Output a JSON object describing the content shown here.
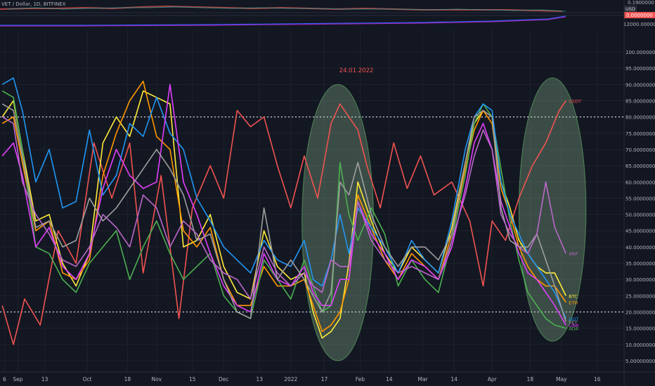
{
  "header": {
    "symbol_line": "VET / Dollar, 1D, BITFINEX"
  },
  "top_panel": {
    "price_axis": {
      "label_top": "0.1900000",
      "label_bottom": "0.0000000",
      "unit": "USD"
    },
    "indicator_axis": {
      "label_top": "12000.0000000"
    }
  },
  "annotation": {
    "date_label": "24.01.2022"
  },
  "colors": {
    "background": "#131722",
    "grid": "#1e222d",
    "axis_text": "#b2b5be",
    "USDT": "#f05350",
    "BTC": "#ffeb3b",
    "ETH": "#ff9800",
    "ADA": "#4caf50",
    "DOT": "#2196f3",
    "LINK": "#e040fb",
    "VET": "#9e9e9e",
    "XRP": "#ba68c8",
    "ellipse_fill": "#a5d6a7",
    "ellipse_stroke": "#66bb6a"
  },
  "chart_data": {
    "type": "line",
    "title": "",
    "xlabel": "",
    "ylabel": "",
    "ylim": [
      0,
      100
    ],
    "yticks": [
      "5.00000000",
      "10.00000000",
      "15.00000000",
      "20.00000000",
      "25.00000000",
      "30.00000000",
      "35.00000000",
      "40.00000000",
      "45.00000000",
      "50.00000000",
      "55.00000000",
      "60.00000000",
      "65.00000000",
      "70.00000000",
      "75.00000000",
      "80.00000000",
      "85.00000000",
      "90.00000000",
      "95.00000000",
      "100.00000000"
    ],
    "ytick_values": [
      5,
      10,
      15,
      20,
      25,
      30,
      35,
      40,
      45,
      50,
      55,
      60,
      65,
      70,
      75,
      80,
      85,
      90,
      95,
      100
    ],
    "xticks": [
      "6",
      "Sep",
      "13",
      "Oct",
      "18",
      "Nov",
      "15",
      "Dec",
      "13",
      "2022",
      "17",
      "Feb",
      "14",
      "Mar",
      "14",
      "Apr",
      "18",
      "May",
      "16"
    ],
    "xtick_days": [
      -4,
      2,
      14,
      33,
      51,
      64,
      80,
      94,
      110,
      124,
      139,
      155,
      168,
      183,
      197,
      214,
      231,
      245,
      261
    ],
    "x_axis_start": "2021-08-27",
    "x_range_days": [
      -6,
      273
    ],
    "reference_lines": [
      80,
      20
    ],
    "series": [
      {
        "name": "USDT",
        "color": "#f05350",
        "end_label": "USDT",
        "label_value": 85,
        "x": [
          -5,
          0,
          5,
          12,
          20,
          28,
          36,
          44,
          52,
          58,
          66,
          74,
          80,
          88,
          94,
          100,
          106,
          112,
          118,
          124,
          130,
          136,
          142,
          146,
          150,
          154,
          158,
          164,
          170,
          176,
          182,
          188,
          196,
          204,
          210,
          214,
          220,
          226,
          232,
          238,
          244,
          247
        ],
        "y": [
          22,
          10,
          24,
          16,
          45,
          35,
          72,
          55,
          72,
          32,
          62,
          18,
          52,
          65,
          55,
          82,
          77,
          80,
          65,
          52,
          68,
          55,
          78,
          84,
          80,
          76,
          65,
          52,
          72,
          58,
          68,
          56,
          60,
          48,
          28,
          48,
          42,
          55,
          65,
          72,
          82,
          85
        ]
      },
      {
        "name": "BTC",
        "color": "#ffeb3b",
        "end_label": "BTC",
        "label_value": 25,
        "x": [
          -5,
          0,
          4,
          10,
          16,
          22,
          28,
          34,
          40,
          46,
          52,
          58,
          64,
          70,
          76,
          82,
          88,
          94,
          100,
          106,
          112,
          118,
          124,
          130,
          134,
          138,
          142,
          146,
          150,
          154,
          160,
          166,
          172,
          178,
          184,
          190,
          196,
          202,
          206,
          210,
          214,
          218,
          222,
          226,
          230,
          234,
          238,
          242,
          247
        ],
        "y": [
          80,
          85,
          70,
          48,
          50,
          35,
          28,
          38,
          72,
          80,
          74,
          88,
          86,
          84,
          40,
          42,
          50,
          34,
          26,
          24,
          45,
          34,
          30,
          32,
          20,
          12,
          14,
          18,
          35,
          60,
          48,
          38,
          32,
          40,
          36,
          32,
          46,
          66,
          78,
          82,
          80,
          60,
          52,
          42,
          38,
          34,
          32,
          32,
          25
        ]
      },
      {
        "name": "ETH",
        "color": "#ff9800",
        "end_label": "ETH",
        "label_value": 23,
        "x": [
          -5,
          0,
          4,
          10,
          16,
          22,
          28,
          34,
          40,
          46,
          52,
          58,
          64,
          70,
          76,
          82,
          88,
          94,
          100,
          106,
          112,
          118,
          124,
          130,
          134,
          138,
          142,
          146,
          150,
          154,
          160,
          166,
          172,
          178,
          184,
          190,
          196,
          202,
          206,
          210,
          214,
          218,
          222,
          226,
          230,
          234,
          238,
          242,
          247
        ],
        "y": [
          78,
          80,
          66,
          45,
          48,
          32,
          30,
          36,
          62,
          75,
          85,
          91,
          74,
          70,
          45,
          40,
          46,
          30,
          22,
          22,
          34,
          28,
          28,
          30,
          22,
          14,
          16,
          20,
          30,
          56,
          46,
          36,
          30,
          38,
          34,
          30,
          44,
          64,
          76,
          82,
          78,
          58,
          50,
          40,
          34,
          30,
          28,
          28,
          23
        ]
      },
      {
        "name": "ADA",
        "color": "#4caf50",
        "end_label": "ADA",
        "label_value": 15,
        "x": [
          -5,
          0,
          4,
          10,
          16,
          22,
          28,
          34,
          40,
          46,
          52,
          58,
          64,
          70,
          76,
          82,
          88,
          94,
          100,
          106,
          112,
          118,
          124,
          130,
          134,
          138,
          142,
          146,
          150,
          154,
          160,
          166,
          172,
          178,
          184,
          190,
          196,
          202,
          206,
          210,
          214,
          218,
          222,
          226,
          230,
          234,
          238,
          242,
          247
        ],
        "y": [
          88,
          86,
          70,
          40,
          38,
          30,
          26,
          35,
          40,
          45,
          30,
          40,
          48,
          38,
          30,
          34,
          38,
          25,
          20,
          18,
          36,
          30,
          24,
          36,
          28,
          20,
          22,
          66,
          50,
          42,
          52,
          44,
          28,
          36,
          30,
          26,
          42,
          62,
          78,
          84,
          80,
          64,
          48,
          36,
          26,
          22,
          18,
          16,
          15
        ]
      },
      {
        "name": "DOT",
        "color": "#2196f3",
        "end_label": "DOT",
        "label_value": 18,
        "x": [
          -5,
          0,
          4,
          10,
          16,
          22,
          28,
          34,
          40,
          46,
          52,
          58,
          64,
          70,
          76,
          82,
          88,
          94,
          100,
          106,
          112,
          118,
          124,
          130,
          134,
          138,
          142,
          146,
          150,
          154,
          160,
          166,
          172,
          178,
          184,
          190,
          196,
          202,
          206,
          210,
          214,
          218,
          222,
          226,
          230,
          234,
          238,
          242,
          247
        ],
        "y": [
          90,
          92,
          82,
          60,
          70,
          52,
          54,
          76,
          56,
          62,
          78,
          74,
          86,
          75,
          70,
          55,
          48,
          40,
          36,
          32,
          42,
          36,
          34,
          42,
          30,
          28,
          36,
          50,
          38,
          52,
          46,
          40,
          32,
          42,
          36,
          32,
          48,
          70,
          80,
          84,
          82,
          60,
          50,
          44,
          38,
          34,
          30,
          26,
          18
        ]
      },
      {
        "name": "LINK",
        "color": "#e040fb",
        "end_label": "LINK",
        "label_value": 16,
        "x": [
          -5,
          0,
          4,
          10,
          16,
          22,
          28,
          34,
          40,
          46,
          52,
          58,
          64,
          70,
          76,
          82,
          88,
          94,
          100,
          106,
          112,
          118,
          124,
          130,
          134,
          138,
          142,
          146,
          150,
          154,
          160,
          166,
          172,
          178,
          184,
          190,
          196,
          202,
          206,
          210,
          214,
          218,
          222,
          226,
          230,
          234,
          238,
          242,
          247
        ],
        "y": [
          68,
          72,
          62,
          40,
          46,
          34,
          30,
          38,
          58,
          70,
          62,
          58,
          60,
          90,
          60,
          50,
          38,
          28,
          22,
          20,
          38,
          30,
          28,
          34,
          26,
          22,
          22,
          30,
          30,
          54,
          44,
          38,
          30,
          36,
          34,
          30,
          40,
          58,
          72,
          78,
          70,
          54,
          46,
          38,
          32,
          30,
          26,
          22,
          16
        ]
      },
      {
        "name": "VET",
        "color": "#9e9e9e",
        "end_label": "VET",
        "label_value": 17,
        "x": [
          -5,
          0,
          4,
          10,
          16,
          22,
          28,
          34,
          40,
          46,
          52,
          58,
          64,
          70,
          76,
          82,
          88,
          94,
          100,
          106,
          112,
          118,
          124,
          130,
          134,
          138,
          142,
          146,
          150,
          154,
          160,
          166,
          172,
          178,
          184,
          190,
          196,
          202,
          206,
          210,
          214,
          218,
          222,
          226,
          230,
          234,
          238,
          242,
          247
        ],
        "y": [
          84,
          82,
          68,
          46,
          48,
          40,
          42,
          55,
          48,
          52,
          58,
          64,
          70,
          64,
          56,
          42,
          44,
          30,
          20,
          18,
          52,
          30,
          36,
          30,
          25,
          20,
          26,
          60,
          56,
          66,
          50,
          40,
          34,
          40,
          40,
          36,
          44,
          66,
          80,
          82,
          80,
          52,
          42,
          40,
          40,
          44,
          36,
          28,
          17
        ]
      },
      {
        "name": "XRP",
        "color": "#ba68c8",
        "end_label": "XRP",
        "label_value": 38,
        "x": [
          -5,
          0,
          4,
          10,
          16,
          22,
          28,
          34,
          40,
          46,
          52,
          58,
          64,
          70,
          76,
          82,
          88,
          94,
          100,
          106,
          112,
          118,
          124,
          130,
          134,
          138,
          142,
          146,
          150,
          154,
          160,
          166,
          172,
          178,
          184,
          190,
          196,
          202,
          206,
          210,
          214,
          218,
          222,
          226,
          230,
          234,
          238,
          242,
          247
        ],
        "y": [
          80,
          78,
          60,
          50,
          44,
          36,
          34,
          40,
          50,
          46,
          40,
          56,
          52,
          40,
          48,
          44,
          36,
          32,
          30,
          24,
          40,
          32,
          28,
          32,
          28,
          26,
          36,
          34,
          34,
          54,
          42,
          36,
          32,
          34,
          32,
          30,
          42,
          56,
          68,
          76,
          70,
          50,
          44,
          40,
          38,
          44,
          60,
          46,
          38
        ]
      }
    ],
    "ellipses": [
      {
        "center_x": 145,
        "center_y": 47.5,
        "rx_days": 16,
        "ry": 42.5
      },
      {
        "center_x": 241,
        "center_y": 51.5,
        "rx_days": 15,
        "ry": 40.5
      }
    ]
  }
}
